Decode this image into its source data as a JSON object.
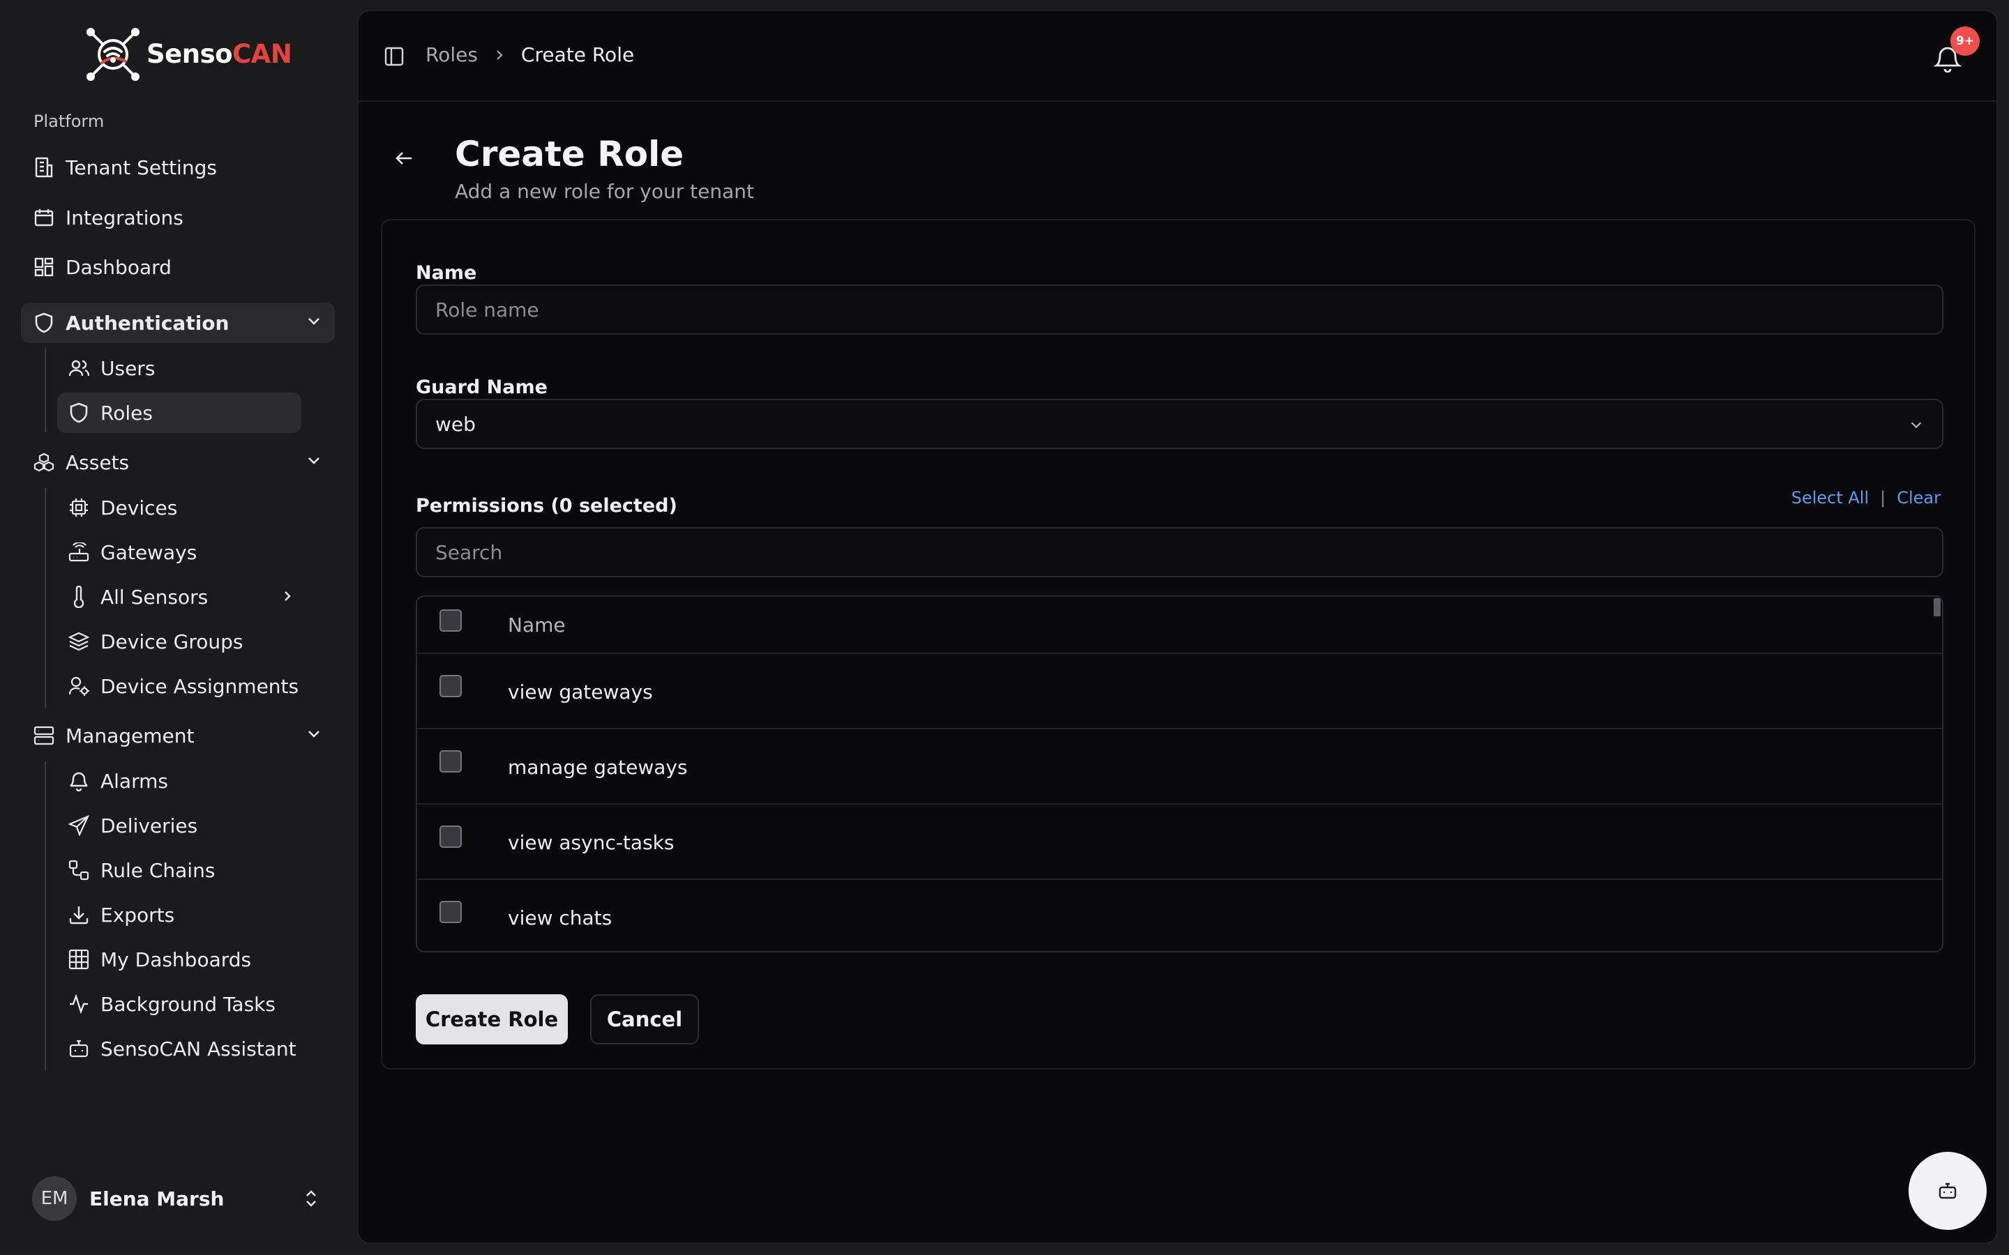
{
  "app": {
    "logo_text_a": "Senso",
    "logo_text_b": "CAN",
    "brand_color": "#e2453b",
    "accent_link_color": "#5b9cf0"
  },
  "sidebar": {
    "section_label": "Platform",
    "platform_items": [
      {
        "label": "Tenant Settings",
        "icon": "building-icon"
      },
      {
        "label": "Integrations",
        "icon": "calendar-icon"
      },
      {
        "label": "Dashboard",
        "icon": "layout-grid-icon"
      }
    ],
    "groups": {
      "authentication": {
        "label": "Authentication",
        "icon": "shield-icon",
        "expanded": true,
        "items": [
          {
            "label": "Users",
            "icon": "users-icon"
          },
          {
            "label": "Roles",
            "icon": "shield-icon",
            "active": true
          }
        ]
      },
      "assets": {
        "label": "Assets",
        "icon": "boxes-icon",
        "expanded": true,
        "items": [
          {
            "label": "Devices",
            "icon": "cpu-icon"
          },
          {
            "label": "Gateways",
            "icon": "router-icon"
          },
          {
            "label": "All Sensors",
            "icon": "thermometer-icon",
            "has_submenu": true
          },
          {
            "label": "Device Groups",
            "icon": "layers-icon"
          },
          {
            "label": "Device Assignments",
            "icon": "user-cog-icon"
          }
        ]
      },
      "management": {
        "label": "Management",
        "icon": "server-icon",
        "expanded": true,
        "items": [
          {
            "label": "Alarms",
            "icon": "bell-icon"
          },
          {
            "label": "Deliveries",
            "icon": "send-icon"
          },
          {
            "label": "Rule Chains",
            "icon": "workflow-icon"
          },
          {
            "label": "Exports",
            "icon": "download-icon"
          },
          {
            "label": "My Dashboards",
            "icon": "table-grid-icon"
          },
          {
            "label": "Background Tasks",
            "icon": "activity-icon"
          },
          {
            "label": "SensoCAN Assistant",
            "icon": "bot-icon"
          }
        ]
      }
    },
    "user": {
      "initials": "EM",
      "name": "Elena Marsh"
    }
  },
  "header": {
    "breadcrumb_root": "Roles",
    "breadcrumb_current": "Create Role",
    "notification_badge": "9+"
  },
  "page": {
    "title": "Create Role",
    "subtitle": "Add a new role for your tenant"
  },
  "form": {
    "name_label": "Name",
    "name_placeholder": "Role name",
    "name_value": "",
    "guard_label": "Guard Name",
    "guard_value": "web",
    "permissions_label": "Permissions (0 selected)",
    "select_all_label": "Select All",
    "clear_label": "Clear",
    "search_placeholder": "Search",
    "table": {
      "column_name": "Name",
      "rows": [
        {
          "name": "view gateways",
          "checked": false
        },
        {
          "name": "manage gateways",
          "checked": false
        },
        {
          "name": "view async-tasks",
          "checked": false
        },
        {
          "name": "view chats",
          "checked": false
        }
      ]
    },
    "submit_label": "Create Role",
    "cancel_label": "Cancel"
  }
}
